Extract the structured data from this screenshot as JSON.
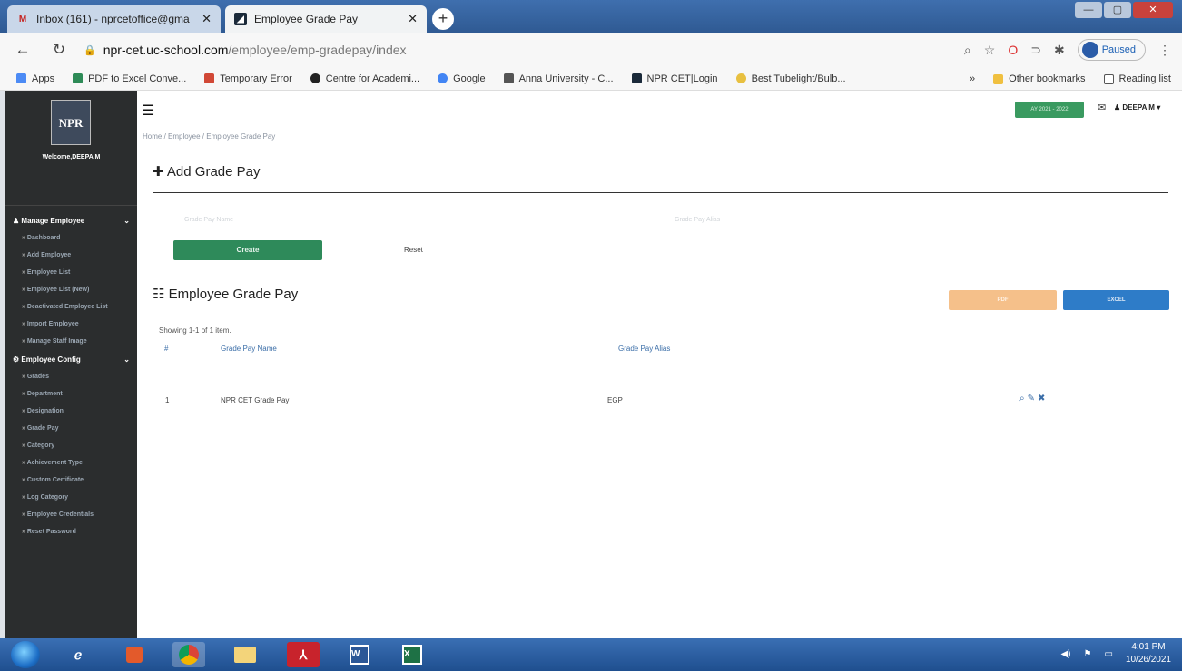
{
  "browser": {
    "tabs": [
      {
        "title": "Inbox (161) - nprcetoffice@gma",
        "icon": "gmail-icon"
      },
      {
        "title": "Employee Grade Pay",
        "icon": "site-icon"
      }
    ],
    "url_host": "npr-cet.uc-school.com",
    "url_path": "/employee/emp-gradepay/index",
    "paused_label": "Paused",
    "bookmarks": [
      "Apps",
      "PDF to Excel Conve...",
      "Temporary Error",
      "Centre for Academi...",
      "Google",
      "Anna University - C...",
      "NPR CET|Login",
      "Best Tubelight/Bulb..."
    ],
    "bookmarks_more": "»",
    "other_bookmarks": "Other bookmarks",
    "reading_list": "Reading list"
  },
  "sidebar": {
    "logo_text": "NPR",
    "welcome": "Welcome,DEEPA M",
    "groups": [
      {
        "label": "Manage Employee",
        "items": [
          "Dashboard",
          "Add Employee",
          "Employee List",
          "Employee List (New)",
          "Deactivated Employee List",
          "Import Employee",
          "Manage Staff Image"
        ]
      },
      {
        "label": "Employee Config",
        "items": [
          "Grades",
          "Department",
          "Designation",
          "Grade Pay",
          "Category",
          "Achievement Type",
          "Custom Certificate",
          "Log Category",
          "Employee Credentials",
          "Reset Password"
        ]
      }
    ]
  },
  "header": {
    "breadcrumb": "Home / Employee / Employee Grade Pay",
    "year_badge": "AY 2021 - 2022",
    "user": "DEEPA M"
  },
  "form": {
    "title": "Add Grade Pay",
    "field1_label": "Grade Pay Name",
    "field2_label": "Grade Pay Alias",
    "create_label": "Create",
    "reset_label": "Reset"
  },
  "list": {
    "title": "Employee Grade Pay",
    "pdf_label": "PDF",
    "excel_label": "EXCEL",
    "summary": "Showing 1-1 of 1 item.",
    "columns": [
      "#",
      "Grade Pay Name",
      "Grade Pay Alias"
    ],
    "rows": [
      [
        "1",
        "NPR CET Grade Pay",
        "EGP"
      ]
    ]
  },
  "taskbar": {
    "time": "4:01 PM",
    "date": "10/26/2021"
  },
  "colors": {
    "sidebar_bg": "#2b2d2e",
    "create_btn": "#2e8a5a",
    "pdf_btn": "#f5c08a",
    "excel_btn": "#2e7cc8",
    "link": "#3b6ea8"
  }
}
